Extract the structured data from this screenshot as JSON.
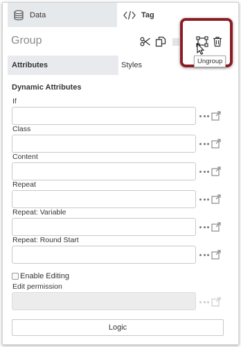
{
  "tabs": {
    "data": "Data",
    "tag": "Tag"
  },
  "group": {
    "title": "Group"
  },
  "subtabs": {
    "attributes": "Attributes",
    "styles": "Styles"
  },
  "section": {
    "title": "Dynamic Attributes"
  },
  "fields": [
    {
      "label": "If",
      "value": ""
    },
    {
      "label": "Class",
      "value": ""
    },
    {
      "label": "Content",
      "value": ""
    },
    {
      "label": "Repeat",
      "value": ""
    },
    {
      "label": "Repeat: Variable",
      "value": ""
    },
    {
      "label": "Repeat: Round Start",
      "value": ""
    }
  ],
  "enable_editing": {
    "label": "Enable Editing",
    "checked": false
  },
  "edit_permission": {
    "label": "Edit permission",
    "value": ""
  },
  "logic_button": "Logic",
  "tooltip": "Ungroup",
  "colors": {
    "highlight": "#8c1c23",
    "tab_bg": "#e6e9ec",
    "icon": "#333333"
  }
}
